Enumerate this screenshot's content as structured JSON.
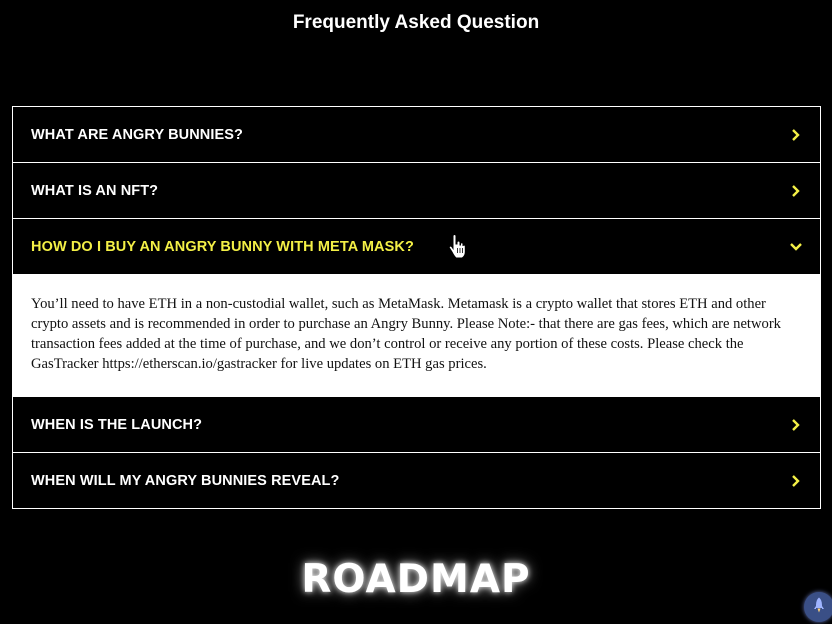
{
  "faq": {
    "title": "Frequently Asked Question",
    "items": [
      {
        "question": "WHAT ARE ANGRY BUNNIES?",
        "open": false
      },
      {
        "question": "WHAT IS AN NFT?",
        "open": false
      },
      {
        "question": "HOW DO I BUY AN ANGRY BUNNY WITH META MASK?",
        "open": true,
        "answer": "You’ll need to have ETH in a non-custodial wallet, such as MetaMask. Metamask is a crypto wallet that stores ETH and other crypto assets and is recommended in order to purchase an Angry Bunny. Please Note:- that there are gas fees, which are network transaction fees added at the time of purchase, and we don’t control or receive any portion of these costs. Please check the GasTracker https://etherscan.io/gastracker for live updates on ETH gas prices."
      },
      {
        "question": "WHEN IS THE LAUNCH?",
        "open": false
      },
      {
        "question": "WHEN WILL MY ANGRY BUNNIES REVEAL?",
        "open": false
      }
    ]
  },
  "roadmap": {
    "title": "ROADMAP"
  },
  "colors": {
    "background": "#000000",
    "accent_yellow": "#f4f046",
    "border": "#ffffff",
    "float_button": "#3a4f86"
  },
  "icons": {
    "collapsed": "chevron-right-icon",
    "expanded": "chevron-down-icon",
    "cursor": "hand-pointer-icon",
    "float_button": "rocket-icon"
  }
}
